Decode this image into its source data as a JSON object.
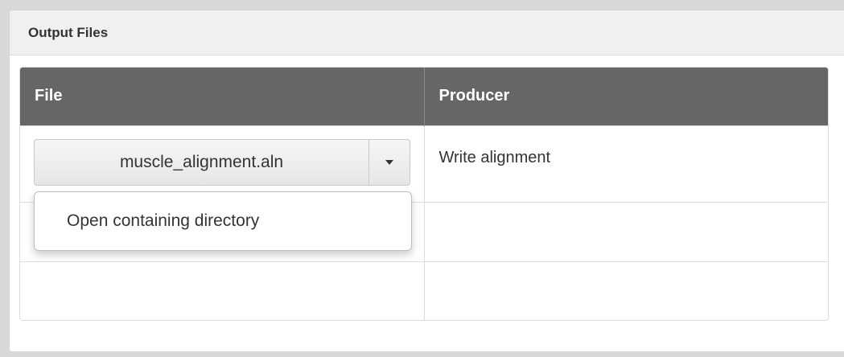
{
  "panel": {
    "title": "Output Files"
  },
  "table": {
    "columns": [
      "File",
      "Producer"
    ],
    "rows": [
      {
        "file": "muscle_alignment.aln",
        "producer": "Write alignment"
      },
      {
        "file": "",
        "producer": ""
      },
      {
        "file": "",
        "producer": ""
      }
    ]
  },
  "dropdown": {
    "items": [
      "Open containing directory"
    ]
  },
  "icons": {
    "caret": "caret-down-icon"
  },
  "colors": {
    "header_bg": "#666666",
    "panel_heading_bg": "#f0f0f0"
  }
}
